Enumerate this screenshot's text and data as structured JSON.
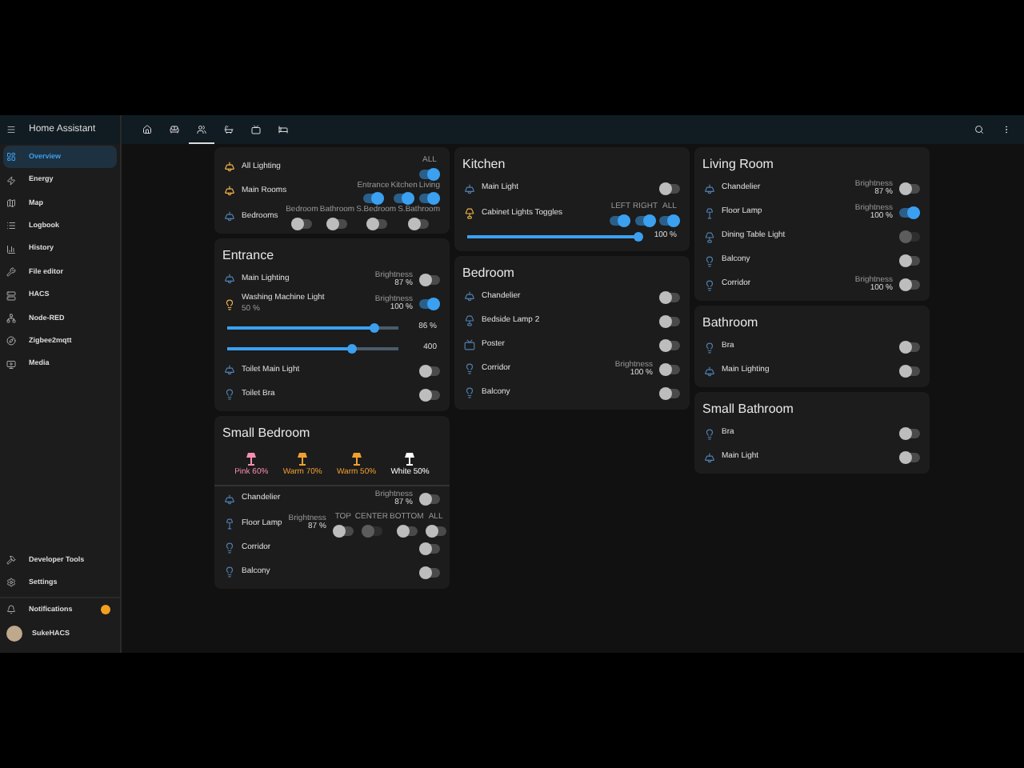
{
  "sidebar": {
    "title": "Home Assistant",
    "items": [
      {
        "label": "Overview",
        "selected": true
      },
      {
        "label": "Energy",
        "selected": false
      },
      {
        "label": "Map",
        "selected": false
      },
      {
        "label": "Logbook",
        "selected": false
      },
      {
        "label": "History",
        "selected": false
      },
      {
        "label": "File editor",
        "selected": false
      },
      {
        "label": "HACS",
        "selected": false
      },
      {
        "label": "Node-RED",
        "selected": false
      },
      {
        "label": "Zigbee2mqtt",
        "selected": false
      },
      {
        "label": "Media",
        "selected": false
      }
    ],
    "bottom_items": [
      {
        "label": "Developer Tools"
      },
      {
        "label": "Settings"
      }
    ],
    "notifications": {
      "label": "Notifications"
    },
    "user": {
      "label": "SukeHACS"
    }
  },
  "view_tabs": [
    {
      "selected": false
    },
    {
      "selected": false
    },
    {
      "selected": true
    },
    {
      "selected": false
    },
    {
      "selected": false
    },
    {
      "selected": false
    }
  ],
  "columns": [
    [
      {
        "rows": [
          {
            "kind": "multi",
            "name": "All Lighting",
            "lit": true,
            "switches": [
              {
                "label": "ALL",
                "on": true,
                "disabled": false
              }
            ]
          },
          {
            "kind": "multi",
            "name": "Main Rooms",
            "lit": true,
            "switches": [
              {
                "label": "Entrance",
                "on": true,
                "disabled": false
              },
              {
                "label": "Kitchen",
                "on": true,
                "disabled": false
              },
              {
                "label": "Living",
                "on": true,
                "disabled": false
              }
            ]
          },
          {
            "kind": "multi",
            "name": "Bedrooms",
            "lit": false,
            "switches": [
              {
                "label": "Bedroom",
                "on": false,
                "disabled": false
              },
              {
                "label": "Bathroom",
                "on": false,
                "disabled": false
              },
              {
                "label": "S.Bedroom",
                "on": false,
                "disabled": false
              },
              {
                "label": "S.Bathroom",
                "on": false,
                "disabled": false
              }
            ]
          }
        ]
      },
      {
        "title": "Entrance",
        "rows": [
          {
            "kind": "multi",
            "name": "Main Lighting",
            "lit": false,
            "attr_label": "Brightness",
            "attr_value": "87 %",
            "switches": [
              {
                "on": false,
                "disabled": false
              }
            ]
          },
          {
            "kind": "multi",
            "name": "Washing Machine Light",
            "sub": "50 %",
            "lit": true,
            "attr_label": "Brightness",
            "attr_value": "100 %",
            "switches": [
              {
                "on": true,
                "disabled": false
              }
            ]
          },
          {
            "kind": "slider",
            "level": 0.86,
            "reading": "86 %"
          },
          {
            "kind": "slider",
            "level": 0.73,
            "reading": "400"
          },
          {
            "kind": "multi",
            "name": "Toilet Main Light",
            "lit": false,
            "switches": [
              {
                "on": false,
                "disabled": false
              }
            ]
          },
          {
            "kind": "multi",
            "name": "Toilet Bra",
            "lit": false,
            "switches": [
              {
                "on": false,
                "disabled": false
              }
            ]
          }
        ]
      },
      {
        "title": "Small Bedroom",
        "rows": [
          {
            "kind": "scenes",
            "scenes": [
              {
                "label": "Pink 60%",
                "color": "#f48fb1"
              },
              {
                "label": "Warm 70%",
                "color": "#f0a030"
              },
              {
                "label": "Warm 50%",
                "color": "#f0a030"
              },
              {
                "label": "White 50%",
                "color": "#ffffff"
              }
            ]
          },
          {
            "kind": "multi",
            "name": "Chandelier",
            "lit": false,
            "attr_label": "Brightness",
            "attr_value": "87 %",
            "switches": [
              {
                "on": false,
                "disabled": false
              }
            ]
          },
          {
            "kind": "multi",
            "name": "Floor Lamp",
            "lit": false,
            "attr_label": "Brightness",
            "attr_value": "87 %",
            "switches": [
              {
                "label": "TOP",
                "on": false,
                "disabled": false
              },
              {
                "label": "CENTER",
                "on": false,
                "disabled": true
              },
              {
                "label": "BOTTOM",
                "on": false,
                "disabled": false
              },
              {
                "label": "ALL",
                "on": false,
                "disabled": false
              }
            ]
          },
          {
            "kind": "multi",
            "name": "Corridor",
            "lit": false,
            "switches": [
              {
                "on": false,
                "disabled": false
              }
            ]
          },
          {
            "kind": "multi",
            "name": "Balcony",
            "lit": false,
            "switches": [
              {
                "on": false,
                "disabled": false
              }
            ]
          }
        ]
      }
    ],
    [
      {
        "title": "Kitchen",
        "rows": [
          {
            "kind": "multi",
            "name": "Main Light",
            "lit": false,
            "switches": [
              {
                "on": false,
                "disabled": false
              }
            ]
          },
          {
            "kind": "multi",
            "name": "Cabinet Lights Toggles",
            "lit": true,
            "switches": [
              {
                "label": "LEFT",
                "on": true,
                "disabled": false
              },
              {
                "label": "RIGHT",
                "on": true,
                "disabled": false
              },
              {
                "label": "ALL",
                "on": true,
                "disabled": false
              }
            ]
          },
          {
            "kind": "slider",
            "level": 1,
            "reading": "100 %"
          }
        ]
      },
      {
        "title": "Bedroom",
        "rows": [
          {
            "kind": "multi",
            "name": "Chandelier",
            "lit": false,
            "switches": [
              {
                "on": false,
                "disabled": false
              }
            ]
          },
          {
            "kind": "multi",
            "name": "Bedside Lamp 2",
            "lit": false,
            "switches": [
              {
                "on": false,
                "disabled": false
              }
            ]
          },
          {
            "kind": "multi",
            "name": "Poster",
            "lit": false,
            "switches": [
              {
                "on": false,
                "disabled": false
              }
            ]
          },
          {
            "kind": "multi",
            "name": "Corridor",
            "lit": false,
            "attr_label": "Brightness",
            "attr_value": "100 %",
            "switches": [
              {
                "on": false,
                "disabled": false
              }
            ]
          },
          {
            "kind": "multi",
            "name": "Balcony",
            "lit": false,
            "switches": [
              {
                "on": false,
                "disabled": false
              }
            ]
          }
        ]
      }
    ],
    [
      {
        "title": "Living Room",
        "rows": [
          {
            "kind": "multi",
            "name": "Chandelier",
            "lit": false,
            "attr_label": "Brightness",
            "attr_value": "87 %",
            "switches": [
              {
                "on": false,
                "disabled": false
              }
            ]
          },
          {
            "kind": "multi",
            "name": "Floor Lamp",
            "lit": false,
            "attr_label": "Brightness",
            "attr_value": "100 %",
            "switches": [
              {
                "on": true,
                "disabled": false
              }
            ]
          },
          {
            "kind": "multi",
            "name": "Dining Table Light",
            "lit": false,
            "switches": [
              {
                "on": false,
                "disabled": true
              }
            ]
          },
          {
            "kind": "multi",
            "name": "Balcony",
            "lit": false,
            "switches": [
              {
                "on": false,
                "disabled": false
              }
            ]
          },
          {
            "kind": "multi",
            "name": "Corridor",
            "lit": false,
            "attr_label": "Brightness",
            "attr_value": "100 %",
            "switches": [
              {
                "on": false,
                "disabled": false
              }
            ]
          }
        ]
      },
      {
        "title": "Bathroom",
        "rows": [
          {
            "kind": "multi",
            "name": "Bra",
            "lit": false,
            "switches": [
              {
                "on": false,
                "disabled": false
              }
            ]
          },
          {
            "kind": "multi",
            "name": "Main Lighting",
            "lit": false,
            "switches": [
              {
                "on": false,
                "disabled": false
              }
            ]
          }
        ]
      },
      {
        "title": "Small Bathroom",
        "rows": [
          {
            "kind": "multi",
            "name": "Bra",
            "lit": false,
            "switches": [
              {
                "on": false,
                "disabled": false
              }
            ]
          },
          {
            "kind": "multi",
            "name": "Main Light",
            "lit": false,
            "switches": [
              {
                "on": false,
                "disabled": false
              }
            ]
          }
        ]
      }
    ]
  ]
}
